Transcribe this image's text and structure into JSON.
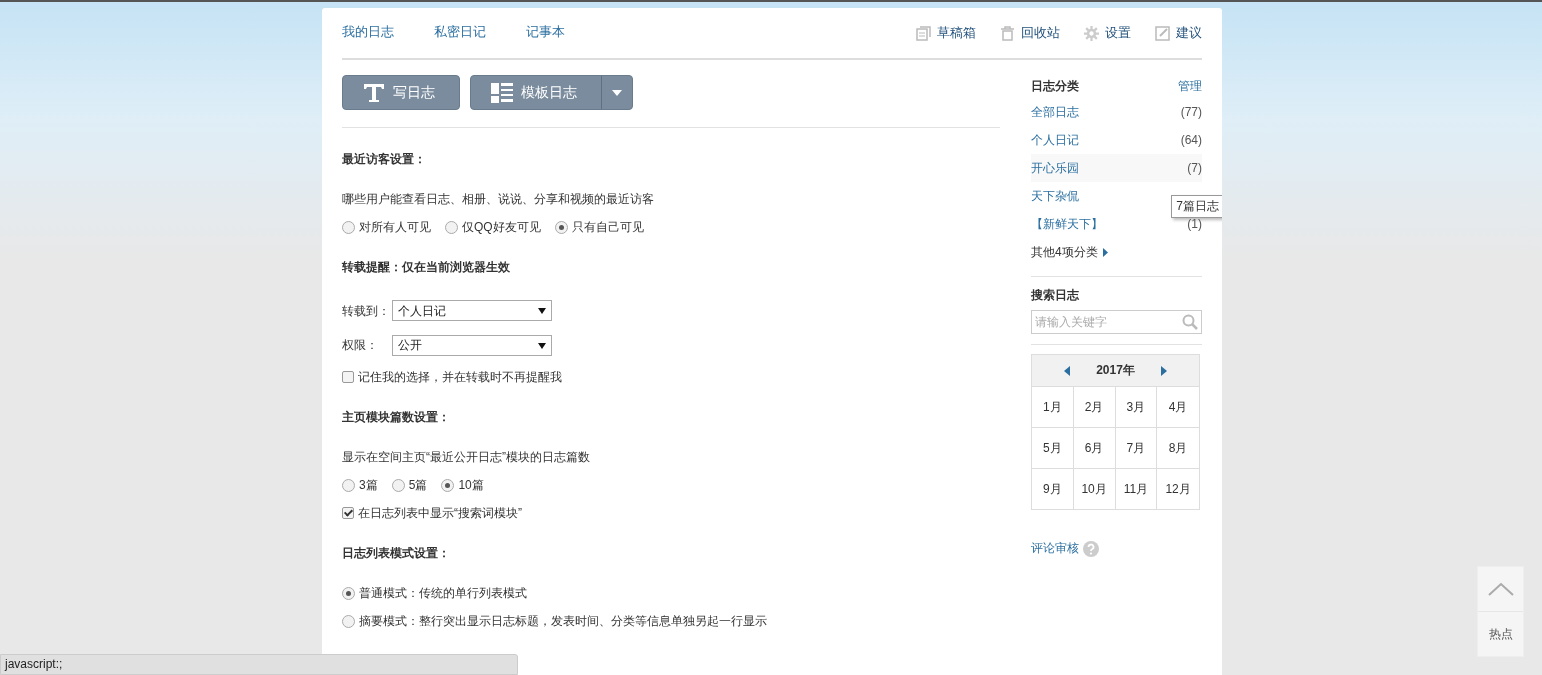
{
  "nav": {
    "tabs": [
      {
        "label": "我的日志"
      },
      {
        "label": "私密日记"
      },
      {
        "label": "记事本"
      }
    ],
    "actions": [
      {
        "label": "草稿箱"
      },
      {
        "label": "回收站"
      },
      {
        "label": "设置"
      },
      {
        "label": "建议"
      }
    ]
  },
  "toolbar": [
    {
      "label": "写日志",
      "kind": "plain"
    },
    {
      "label": "模板日志",
      "kind": "split"
    }
  ],
  "sections": [
    {
      "heading": "最近访客设置：",
      "items": [
        {
          "kind": "text",
          "text": "哪些用户能查看日志、相册、说说、分享和视频的最近访客"
        },
        {
          "kind": "radios",
          "options": [
            {
              "label": "对所有人可见",
              "selected": false
            },
            {
              "label": "仅QQ好友可见",
              "selected": false
            },
            {
              "label": "只有自己可见",
              "selected": true
            }
          ]
        }
      ]
    },
    {
      "heading": "转载提醒：仅在当前浏览器生效",
      "items": [
        {
          "kind": "select",
          "label": "转载到：",
          "value": "个人日记"
        },
        {
          "kind": "select",
          "label": "权限：",
          "value": "公开"
        },
        {
          "kind": "checkbox",
          "label": "记住我的选择，并在转载时不再提醒我",
          "checked": false
        }
      ]
    },
    {
      "heading": "主页模块篇数设置：",
      "items": [
        {
          "kind": "text",
          "text": "显示在空间主页“最近公开日志”模块的日志篇数"
        },
        {
          "kind": "radios",
          "options": [
            {
              "label": "3篇",
              "selected": false
            },
            {
              "label": "5篇",
              "selected": false
            },
            {
              "label": "10篇",
              "selected": true
            }
          ]
        },
        {
          "kind": "checkbox",
          "label": "在日志列表中显示“搜索词模块”",
          "checked": true
        }
      ]
    },
    {
      "heading": "日志列表模式设置：",
      "items": [
        {
          "kind": "radio",
          "label": "普通模式：传统的单行列表模式",
          "selected": true
        },
        {
          "kind": "radio",
          "label": "摘要模式：整行突出显示日志标题，发表时间、分类等信息单独另起一行显示",
          "selected": false
        }
      ]
    }
  ],
  "sidebar": {
    "categories": {
      "title": "日志分类",
      "manage": "管理",
      "items": [
        {
          "name": "全部日志",
          "count": "(77)",
          "hovered": false
        },
        {
          "name": "个人日记",
          "count": "(64)",
          "hovered": false
        },
        {
          "name": "开心乐园",
          "count": "(7)",
          "hovered": true
        },
        {
          "name": "天下杂侃",
          "hovered": false
        },
        {
          "name": "【新鲜天下】",
          "count": "(1)",
          "hovered": false
        }
      ],
      "more": "其他4项分类",
      "tooltip": "7篇日志"
    },
    "search": {
      "title": "搜索日志",
      "placeholder": "请输入关键字"
    },
    "calendar": {
      "year": "2017年",
      "months": [
        "1月",
        "2月",
        "3月",
        "4月",
        "5月",
        "6月",
        "7月",
        "8月",
        "9月",
        "10月",
        "11月",
        "12月"
      ]
    },
    "review": "评论审核"
  },
  "back_to_top": {
    "label": "热点"
  },
  "status_bar": "javascript:;"
}
